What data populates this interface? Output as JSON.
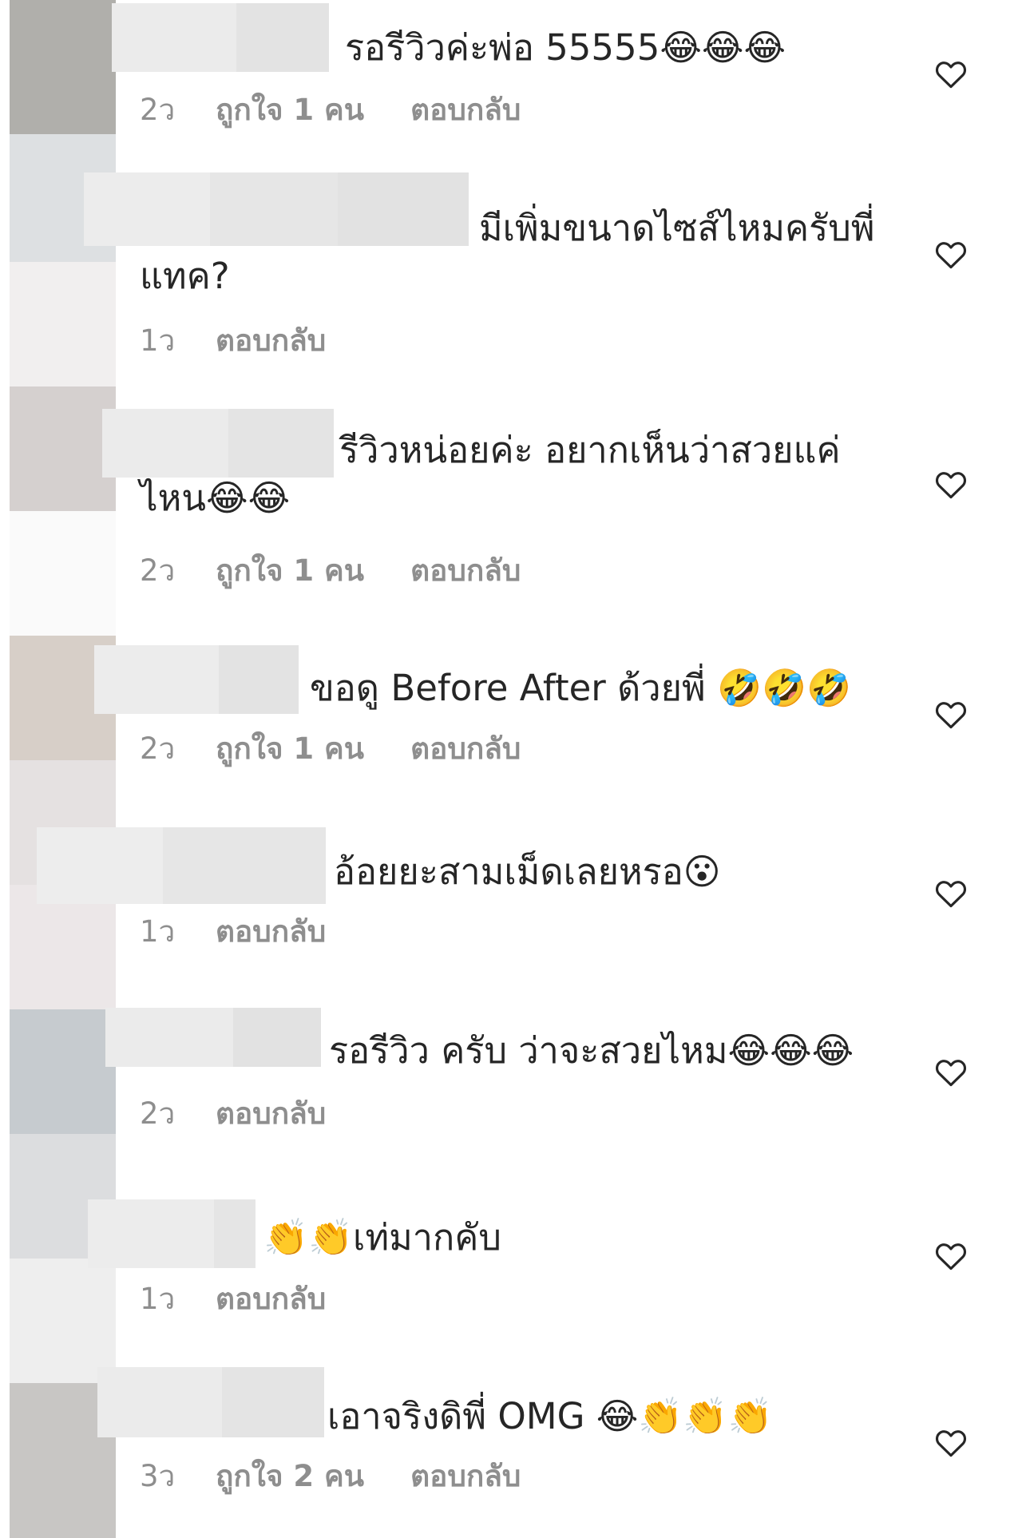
{
  "avatar_strip_colors": [
    "#b0afab",
    "#dde0e2",
    "#f1efef",
    "#d5d0cf",
    "#fafafa",
    "#d7cfc8",
    "#e5e1e1",
    "#ece7e8",
    "#c6cbcf",
    "#dcdddf",
    "#eeeeee",
    "#c8c6c4"
  ],
  "heart_icon": "heart-outline-icon",
  "comments": [
    {
      "text_line1": "รอรีวิวค่ะพ่อ 55555😂😂😂",
      "text_line2": "",
      "time": "2ว",
      "likes": "ถูกใจ 1 คน",
      "reply": "ตอบกลับ"
    },
    {
      "text_line1": "มีเพิ่มขนาดไซส์ไหมครับพี่",
      "text_line2": "แทค?",
      "time": "1ว",
      "likes": "",
      "reply": "ตอบกลับ"
    },
    {
      "text_line1": "รีวิวหน่อยค่ะ อยากเห็นว่าสวยแค่",
      "text_line2": "ไหน😂😂",
      "time": "2ว",
      "likes": "ถูกใจ 1 คน",
      "reply": "ตอบกลับ"
    },
    {
      "text_line1": "ขอดู Before After ด้วยพี่ 🤣🤣🤣",
      "text_line2": "",
      "time": "2ว",
      "likes": "ถูกใจ 1 คน",
      "reply": "ตอบกลับ"
    },
    {
      "text_line1": "อ้อยยะสามเม็ดเลยหรอ😮",
      "text_line2": "",
      "time": "1ว",
      "likes": "",
      "reply": "ตอบกลับ"
    },
    {
      "text_line1": "รอรีวิว ครับ ว่าจะสวยไหม😂😂😂",
      "text_line2": "",
      "time": "2ว",
      "likes": "",
      "reply": "ตอบกลับ"
    },
    {
      "text_line1": "👏👏เท่มากคับ",
      "text_line2": "",
      "time": "1ว",
      "likes": "",
      "reply": "ตอบกลับ"
    },
    {
      "text_line1": "เอาจริงดิพี่ OMG 😂👏👏👏",
      "text_line2": "",
      "time": "3ว",
      "likes": "ถูกใจ 2 คน",
      "reply": "ตอบกลับ"
    }
  ]
}
